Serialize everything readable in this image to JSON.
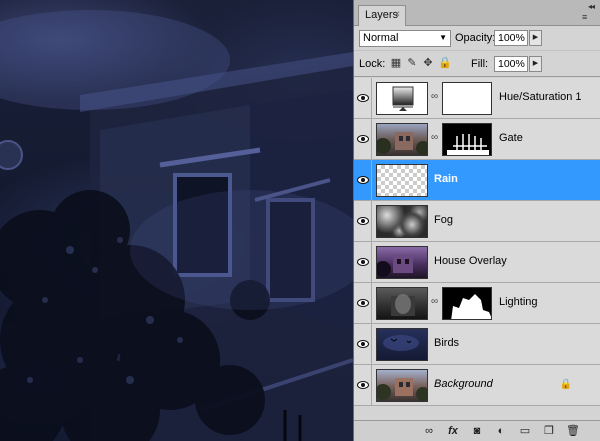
{
  "panel": {
    "tab_label": "Layers",
    "tab_close": "×",
    "collapse_glyph": "◂◂",
    "menu_glyph": "≡"
  },
  "options": {
    "blend_mode": "Normal",
    "opacity_label": "Opacity:",
    "opacity_value": "100%",
    "lock_label": "Lock:",
    "fill_label": "Fill:",
    "fill_value": "100%"
  },
  "layers": [
    {
      "name": "Hue/Saturation 1",
      "kind": "adjustment",
      "has_mask": true,
      "selected": false
    },
    {
      "name": "Gate",
      "kind": "image",
      "has_mask": true,
      "selected": false
    },
    {
      "name": "Rain",
      "kind": "transparent",
      "has_mask": false,
      "selected": true
    },
    {
      "name": "Fog",
      "kind": "fog",
      "has_mask": false,
      "selected": false
    },
    {
      "name": "House Overlay",
      "kind": "image-purple",
      "has_mask": false,
      "selected": false
    },
    {
      "name": "Lighting",
      "kind": "image-gray",
      "has_mask": true,
      "selected": false
    },
    {
      "name": "Birds",
      "kind": "birds",
      "has_mask": false,
      "selected": false
    },
    {
      "name": "Background",
      "kind": "image",
      "has_mask": false,
      "selected": false,
      "locked": true
    }
  ],
  "colors": {
    "selection": "#3399ff",
    "panel_bg": "#d4d4d4"
  },
  "footer_icons": [
    "link-layers-icon",
    "fx-icon",
    "add-mask-icon",
    "adjustment-layer-icon",
    "new-group-icon",
    "new-layer-icon",
    "trash-icon"
  ]
}
